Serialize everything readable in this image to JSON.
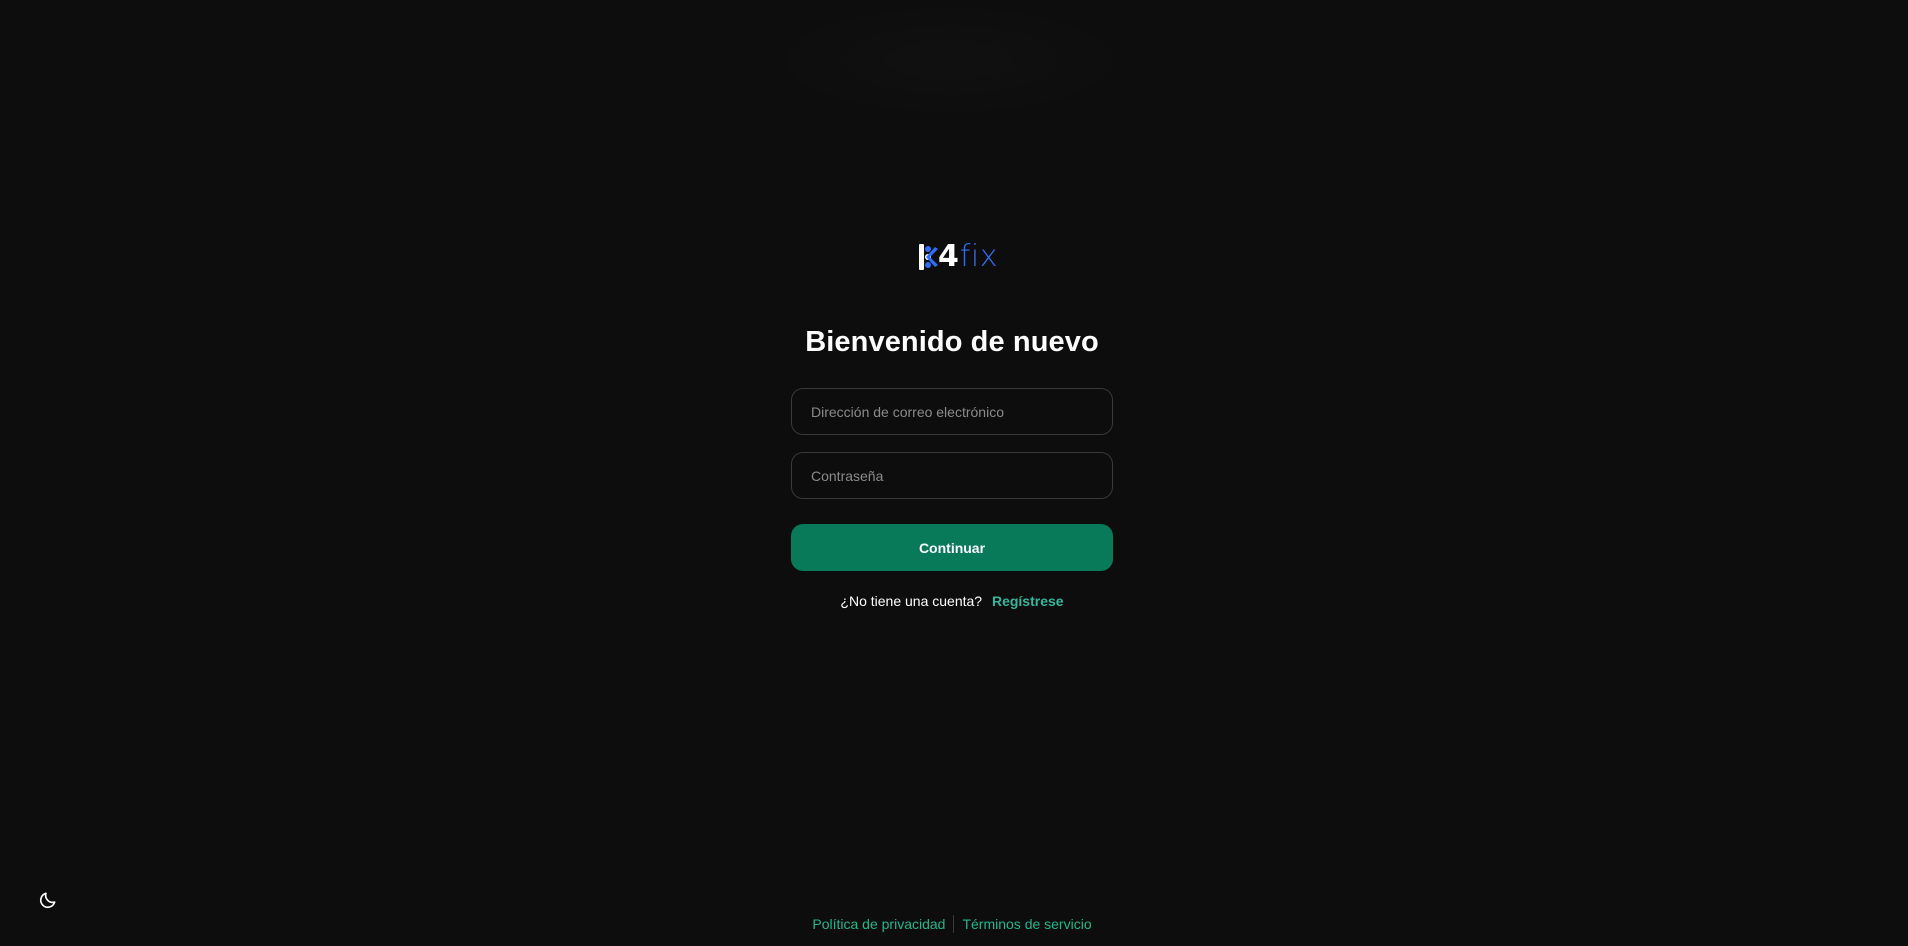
{
  "brand": {
    "logo_number": "4",
    "logo_word": "fix",
    "icon": "k4fix-logo-icon"
  },
  "login": {
    "title": "Bienvenido de nuevo",
    "email_placeholder": "Dirección de correo electrónico",
    "email_value": "",
    "password_placeholder": "Contraseña",
    "password_value": "",
    "continue_label": "Continuar",
    "signup_prompt": "¿No tiene una cuenta?",
    "signup_link": "Regístrese"
  },
  "footer": {
    "privacy_label": "Política de privacidad",
    "terms_label": "Términos de servicio"
  },
  "theme": {
    "toggle_icon": "moon-icon"
  },
  "colors": {
    "background": "#0d0d0d",
    "primary": "#087a59",
    "link": "#35b59a",
    "brand_blue": "#2f6df6"
  }
}
